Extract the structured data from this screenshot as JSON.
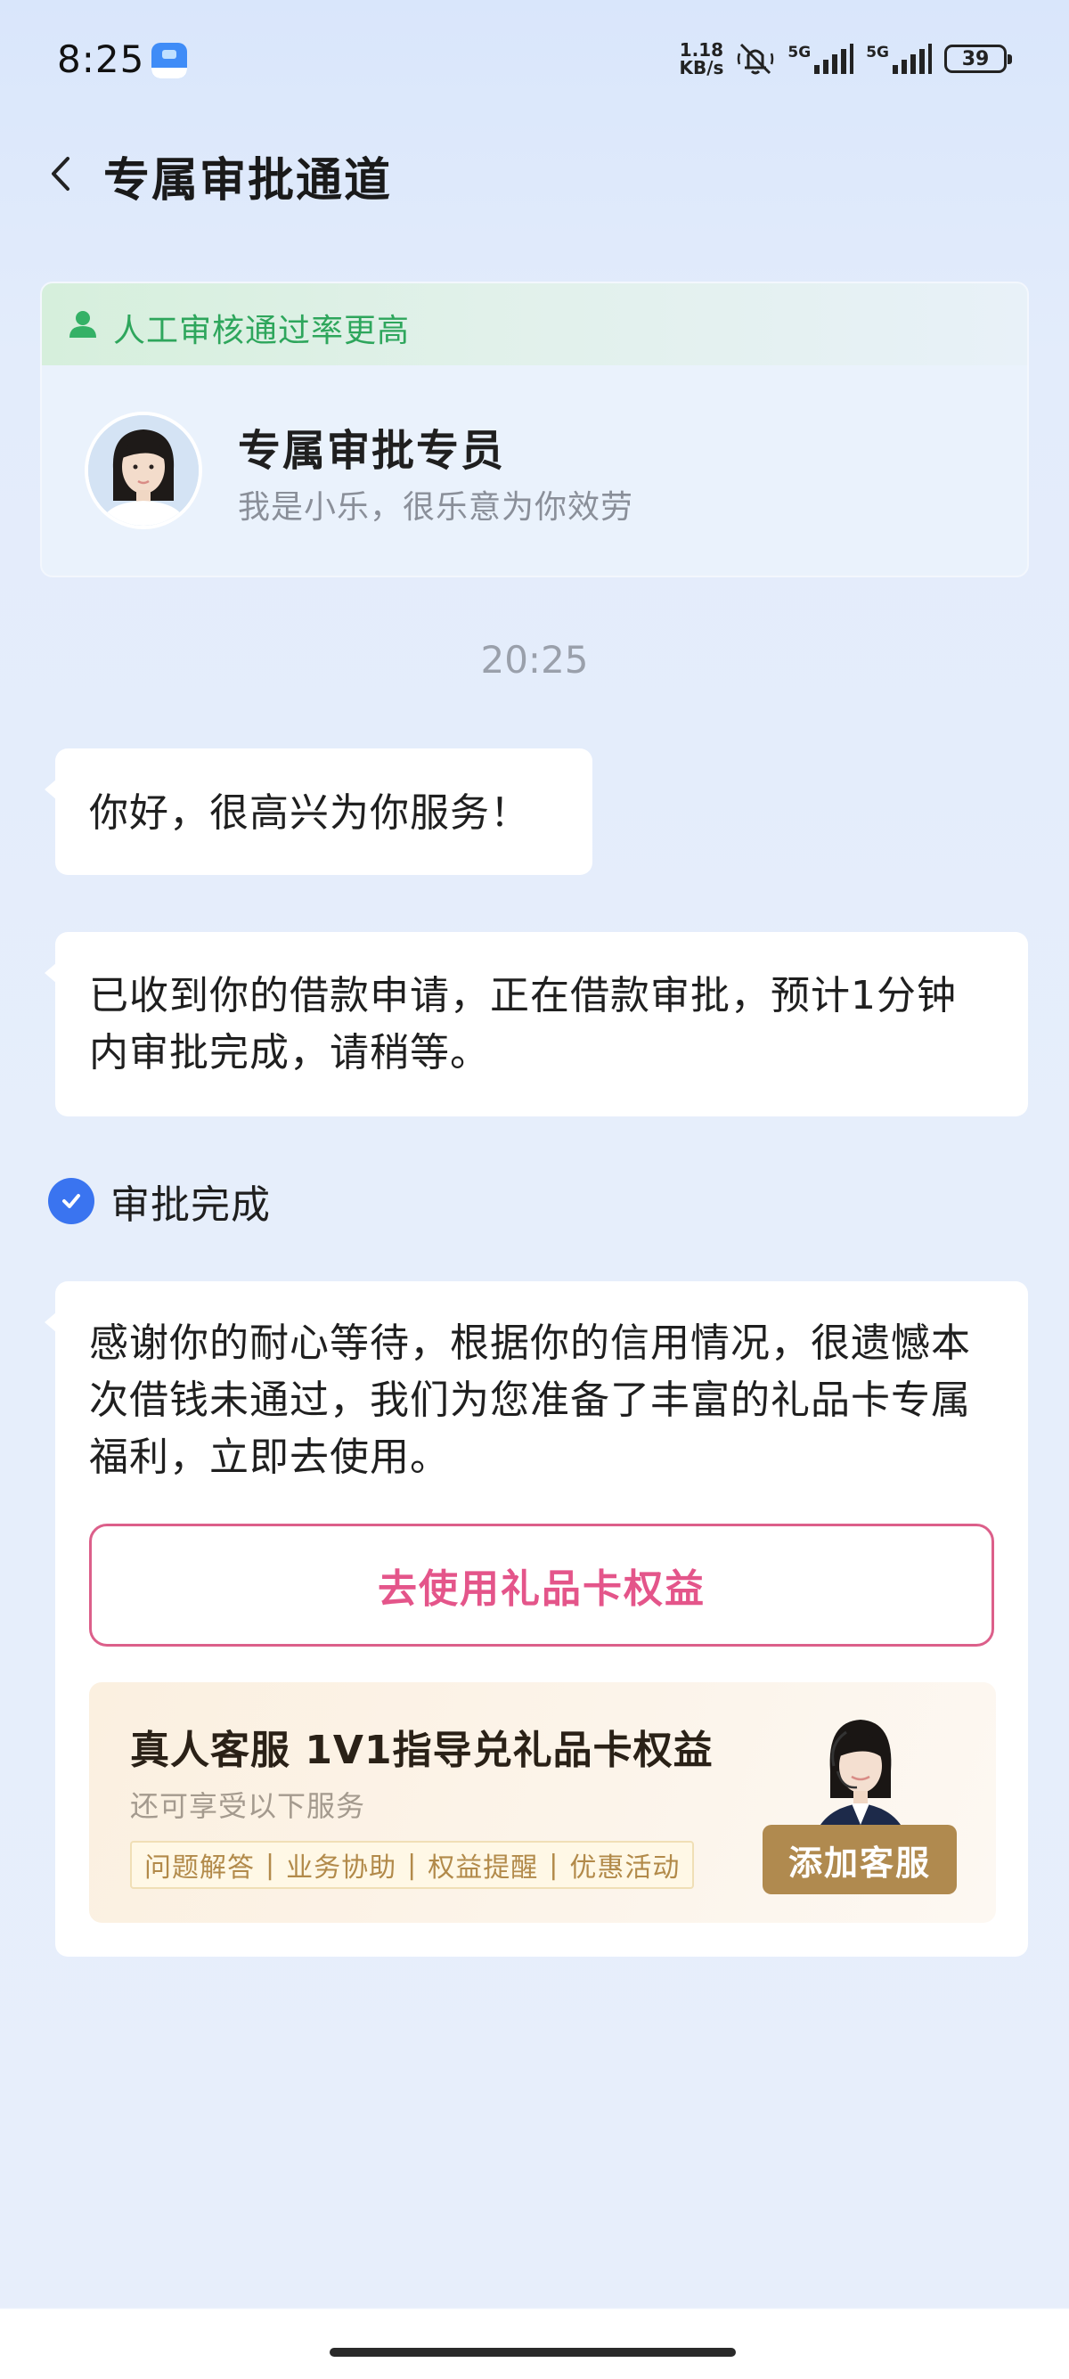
{
  "status_bar": {
    "time": "8:25",
    "speed_value": "1.18",
    "speed_unit": "KB/s",
    "signal1_label": "5G",
    "signal2_label": "5G",
    "battery": "39"
  },
  "header": {
    "title": "专属审批通道"
  },
  "agent_card": {
    "banner": "人工审核通过率更高",
    "name": "专属审批专员",
    "subtitle": "我是小乐，很乐意为你效劳"
  },
  "chat": {
    "timestamp": "20:25",
    "greeting": "你好，很高兴为你服务！",
    "received": "已收到你的借款申请，正在借款审批，预计1分钟内审批完成，请稍等。",
    "approval_status": "审批完成",
    "result": "感谢你的耐心等待，根据你的信用情况，很遗憾本次借钱未通过，我们为您准备了丰富的礼品卡专属福利，立即去使用。",
    "gift_button": "去使用礼品卡权益"
  },
  "service": {
    "title": "真人客服 1V1指导兑礼品卡权益",
    "subtitle": "还可享受以下服务",
    "tags": [
      "问题解答",
      "业务协助",
      "权益提醒",
      "优惠活动"
    ],
    "add_button": "添加客服"
  },
  "colors": {
    "accent_blue": "#3a74f0",
    "green": "#2ea65c",
    "pink": "#e4558a",
    "gold": "#b08a4f"
  }
}
